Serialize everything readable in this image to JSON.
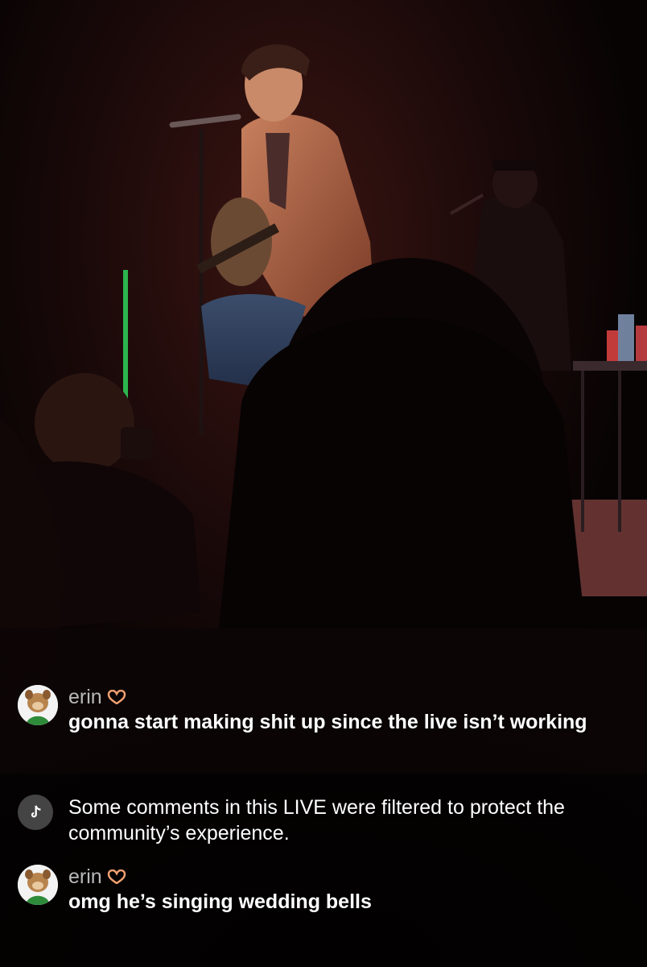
{
  "comments": [
    {
      "username": "erin",
      "emoji_icon": "heart-hands-icon",
      "text": "gonna start making shit up since the live isn’t working"
    },
    {
      "system": true,
      "icon": "tiktok-logo-icon",
      "text": "Some comments in this LIVE were filtered to protect the community’s experience."
    },
    {
      "username": "erin",
      "emoji_icon": "heart-hands-icon",
      "text": "omg he’s singing wedding bells"
    }
  ],
  "colors": {
    "background": "#0a0405",
    "stage_light": "#b85a3a",
    "text": "#ffffff"
  }
}
